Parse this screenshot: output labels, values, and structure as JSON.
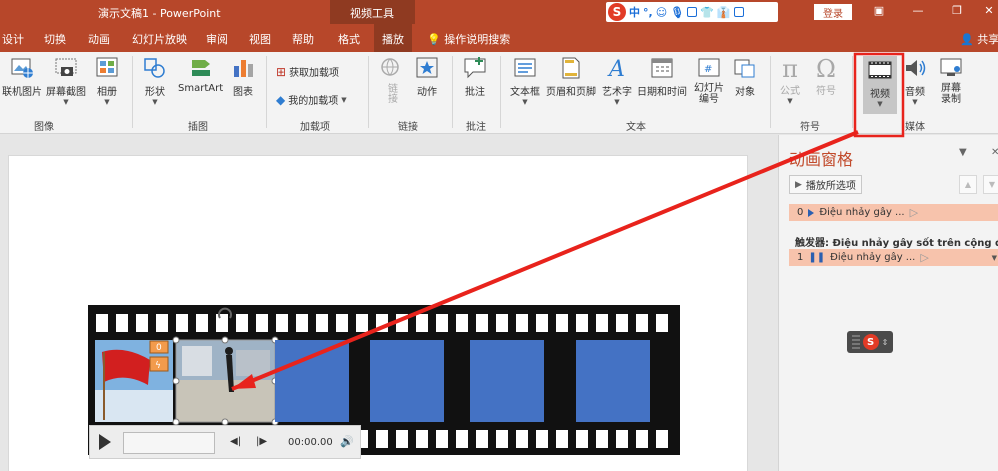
{
  "titlebar": {
    "title": "演示文稿1  -  PowerPoint",
    "context_label": "视频工具",
    "login": "登录",
    "ime_label": "中"
  },
  "tabs": [
    "设计",
    "切换",
    "动画",
    "幻灯片放映",
    "审阅",
    "视图",
    "帮助",
    "格式",
    "播放"
  ],
  "active_tab": "播放",
  "tell_me": "操作说明搜索",
  "share": "共享",
  "ribbon": {
    "buttons": {
      "online_picture": "联机图片",
      "screenshot": "屏幕截图",
      "photo_album": "相册",
      "shapes": "形状",
      "smartart": "SmartArt",
      "chart": "图表",
      "get_addins": "获取加载项",
      "my_addins": "我的加载项",
      "link": "链接",
      "action": "动作",
      "comment": "批注",
      "textbox": "文本框",
      "header_footer": "页眉和页脚",
      "wordart": "艺术字",
      "datetime": "日期和时间",
      "slide_number": "幻灯片\n编号",
      "object": "对象",
      "equation": "公式",
      "symbol": "符号",
      "video": "视频",
      "audio": "音频",
      "screen_recording": "屏幕\n录制"
    },
    "groups": {
      "images": "图像",
      "illustrations": "插图",
      "addins": "加载项",
      "links": "链接",
      "comments": "批注",
      "text": "文本",
      "symbols": "符号",
      "media": "媒体"
    }
  },
  "animation_pane": {
    "title": "动画窗格",
    "play_selected": "播放所选项",
    "items": [
      {
        "index": "0",
        "label": "Điệu nhảy gây ..."
      },
      {
        "index": "1",
        "label": "Điệu nhảy gây ..."
      }
    ],
    "trigger_label": "触发器: Điệu nhảy gây sốt trên cộng đ..."
  },
  "media_controls": {
    "time": "00:00.00"
  },
  "colors": {
    "accent": "#b7472a",
    "accent_dark": "#8f3a21",
    "highlight_box": "#e8231c",
    "anim_item_bg": "#f7c3ac",
    "placeholder_blue": "#4472c4"
  }
}
